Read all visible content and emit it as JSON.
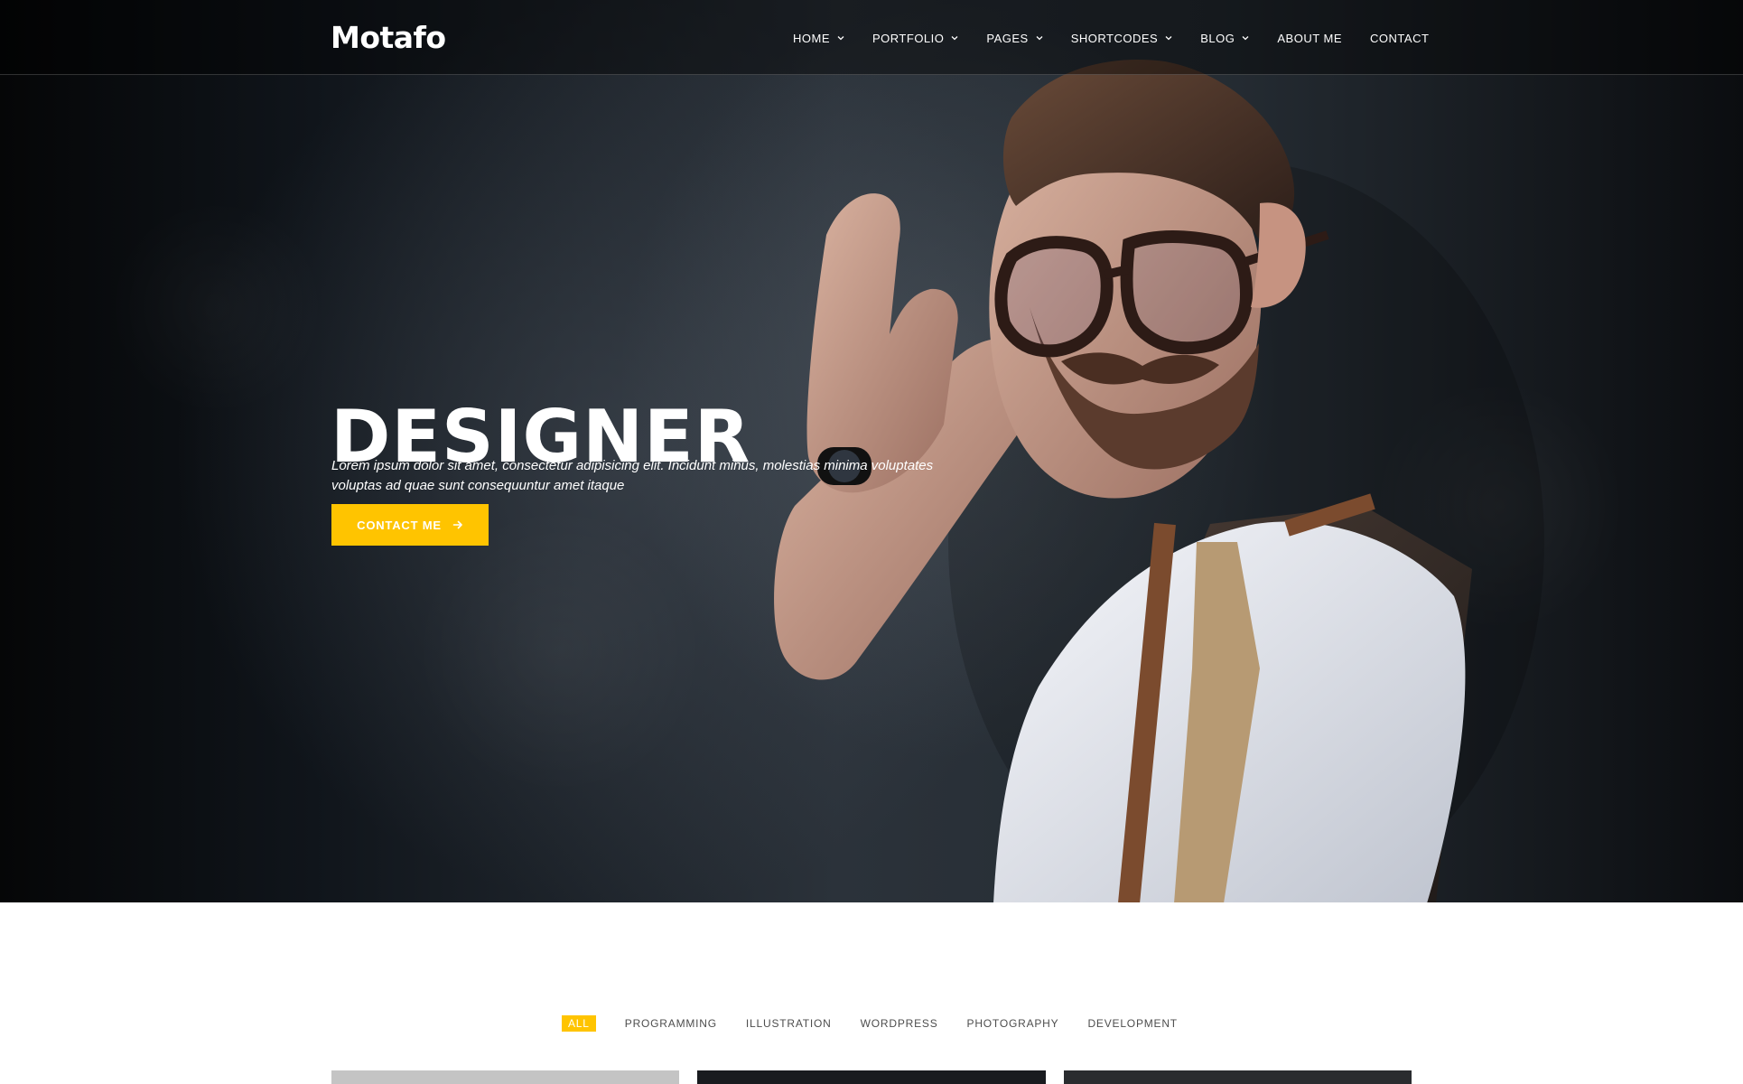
{
  "header": {
    "logo": "Motafo",
    "nav": [
      {
        "label": "HOME",
        "has_dropdown": true
      },
      {
        "label": "PORTFOLIO",
        "has_dropdown": true
      },
      {
        "label": "PAGES",
        "has_dropdown": true
      },
      {
        "label": "SHORTCODES",
        "has_dropdown": true
      },
      {
        "label": "BLOG",
        "has_dropdown": true
      },
      {
        "label": "ABOUT ME",
        "has_dropdown": false
      },
      {
        "label": "CONTACT",
        "has_dropdown": false
      }
    ]
  },
  "hero": {
    "title": "DESIGNER",
    "copy": "Lorem ipsum dolor sit amet, consectetur adipisicing elit. Incidunt minus, molestias minima voluptates voluptas ad quae sunt consequuntur amet itaque",
    "cta_label": "CONTACT ME",
    "cta_icon": "arrow-right-icon"
  },
  "portfolio": {
    "filters": [
      {
        "label": "ALL",
        "active": true
      },
      {
        "label": "PROGRAMMING",
        "active": false
      },
      {
        "label": "ILLUSTRATION",
        "active": false
      },
      {
        "label": "WORDPRESS",
        "active": false
      },
      {
        "label": "PHOTOGRAPHY",
        "active": false
      },
      {
        "label": "DEVELOPMENT",
        "active": false
      }
    ]
  },
  "colors": {
    "accent": "#ffc400",
    "hero_dark": "#0b0d10",
    "text_light": "#ffffff",
    "text_muted": "#4d4d4d"
  }
}
